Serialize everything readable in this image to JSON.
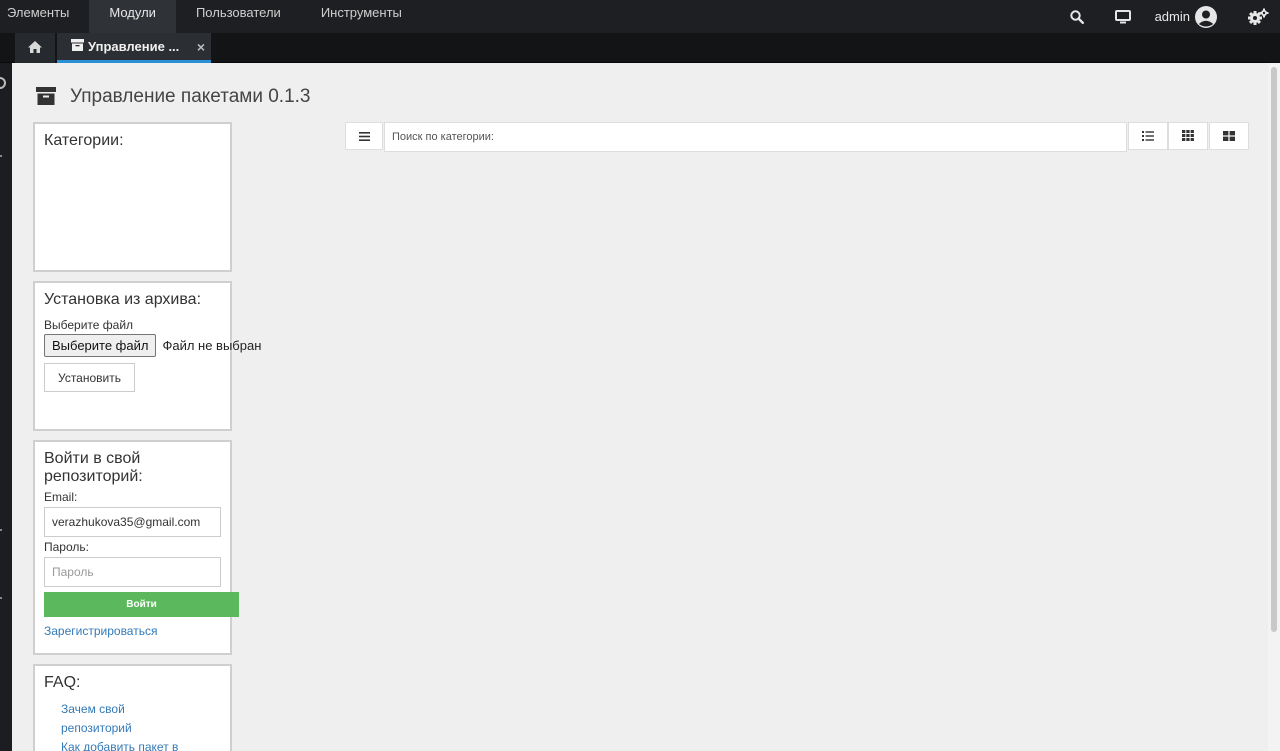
{
  "topnav": {
    "items": [
      {
        "label": "Элементы"
      },
      {
        "label": "Модули"
      },
      {
        "label": "Пользователи"
      },
      {
        "label": "Инструменты"
      }
    ],
    "user": "admin"
  },
  "tabs": {
    "active_label": "Управление ...",
    "close": "×"
  },
  "page": {
    "title": "Управление пакетами 0.1.3"
  },
  "categories": {
    "title": "Категории:"
  },
  "archive": {
    "title": "Установка из архива:",
    "file_label": "Выберите файл",
    "file_button": "Выберите файл",
    "file_status": "Файл не выбран",
    "install_button": "Установить"
  },
  "login": {
    "title": "Войти в свой репозиторий:",
    "email_label": "Email:",
    "email_value": "verazhukova35@gmail.com",
    "password_label": "Пароль:",
    "password_placeholder": "Пароль",
    "submit": "Войти",
    "register": "Зарегистрироваться"
  },
  "faq": {
    "title": "FAQ:",
    "items": [
      {
        "label": "Зачем свой репозиторий"
      },
      {
        "label": "Как добавить пакет в"
      }
    ]
  },
  "toolbar": {
    "search_placeholder": "Поиск по категории:"
  },
  "colors": {
    "accent": "#2a8fd4",
    "success": "#5cb85c",
    "link": "#337ab7"
  },
  "icons": [
    "search-icon",
    "monitor-icon",
    "user-circle-icon",
    "gears-icon",
    "home-icon",
    "archive-icon",
    "bars-icon",
    "list-view-icon",
    "grid-view-icon",
    "tiles-view-icon"
  ]
}
